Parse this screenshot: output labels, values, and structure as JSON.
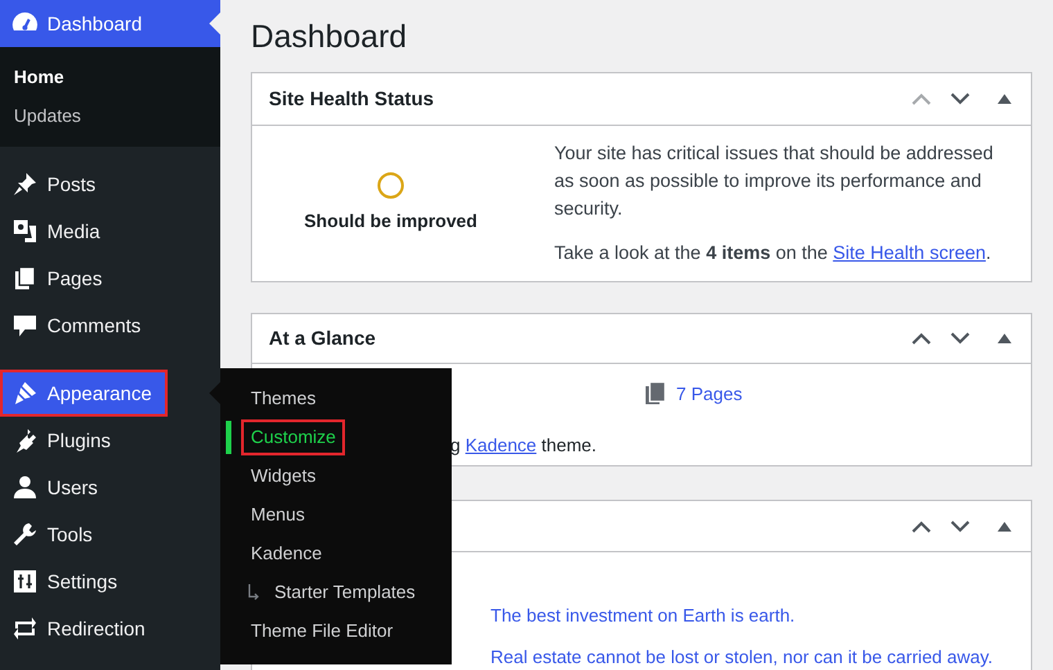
{
  "sidebar": {
    "items": [
      {
        "label": "Dashboard",
        "selected": true,
        "open": false,
        "outlined": false,
        "submenu": [
          {
            "label": "Home",
            "selected": true
          },
          {
            "label": "Updates",
            "selected": false
          }
        ]
      },
      {
        "label": "Posts",
        "selected": false,
        "open": false,
        "outlined": false
      },
      {
        "label": "Media",
        "selected": false,
        "open": false,
        "outlined": false
      },
      {
        "label": "Pages",
        "selected": false,
        "open": false,
        "outlined": false
      },
      {
        "label": "Comments",
        "selected": false,
        "open": false,
        "outlined": false
      },
      {
        "label": "Appearance",
        "selected": true,
        "open": true,
        "outlined": true
      },
      {
        "label": "Plugins",
        "selected": false,
        "open": false,
        "outlined": false
      },
      {
        "label": "Users",
        "selected": false,
        "open": false,
        "outlined": false
      },
      {
        "label": "Tools",
        "selected": false,
        "open": false,
        "outlined": false
      },
      {
        "label": "Settings",
        "selected": false,
        "open": false,
        "outlined": false
      },
      {
        "label": "Redirection",
        "selected": false,
        "open": false,
        "outlined": false
      }
    ]
  },
  "flyout": {
    "items": [
      {
        "label": "Themes",
        "kind": "item",
        "selected": false,
        "outlined": false
      },
      {
        "label": "Customize",
        "kind": "item",
        "selected": true,
        "outlined": true
      },
      {
        "label": "Widgets",
        "kind": "item",
        "selected": false,
        "outlined": false
      },
      {
        "label": "Menus",
        "kind": "item",
        "selected": false,
        "outlined": false
      },
      {
        "label": "Kadence",
        "kind": "item",
        "selected": false,
        "outlined": false
      },
      {
        "label": "Starter Templates",
        "kind": "child",
        "selected": false,
        "outlined": false
      },
      {
        "label": "Theme File Editor",
        "kind": "item",
        "selected": false,
        "outlined": false
      }
    ]
  },
  "page_title": "Dashboard",
  "site_health": {
    "title": "Site Health Status",
    "move_up_disabled": true,
    "status": "Should be improved",
    "message": "Your site has critical issues that should be addressed as soon as possible to improve its performance and security.",
    "prompt": "Take a look at the **4 items** on the ",
    "link": "Site Health screen",
    "prompt_end": "."
  },
  "at_a_glance": {
    "title": "At a Glance",
    "move_up_disabled": false,
    "pages": "7 Pages",
    "theme_prefix": "g",
    "theme_link": "Kadence",
    "theme_suffix": "theme."
  },
  "third_panel": {
    "move_up_disabled": false,
    "quotes": [
      "The best investment on Earth is earth.",
      "Real estate cannot be lost or stolen, nor can it be carried away."
    ]
  }
}
